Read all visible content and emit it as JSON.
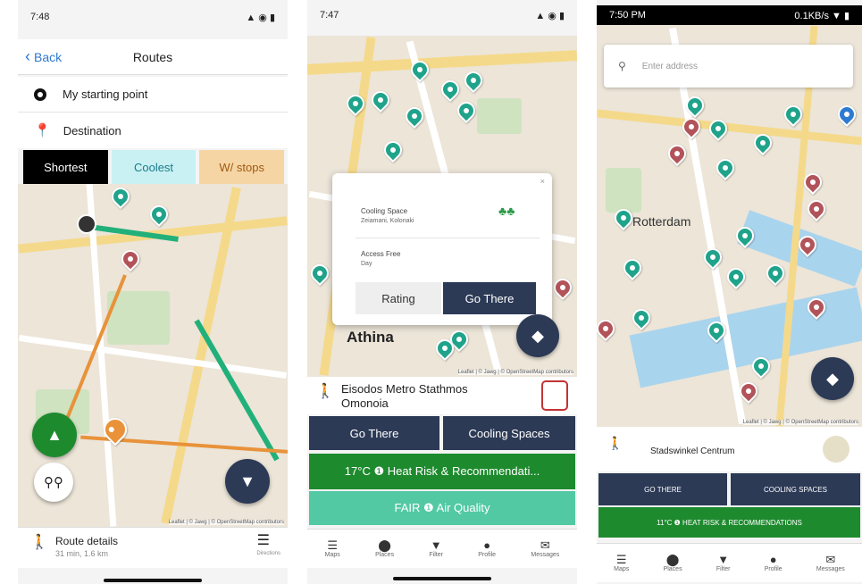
{
  "colors": {
    "teal": "#1fa38a",
    "navy": "#2c3a56",
    "green": "#1e8a2e",
    "mint": "#52c9a3",
    "shortest_bg": "#000000",
    "coolest_bg": "#c9f1f4",
    "stops_bg": "#f6d5a5"
  },
  "phone1": {
    "status": {
      "time": "7:48",
      "icons": "▲ ◉ ▮"
    },
    "header": {
      "back_label": "Back",
      "title": "Routes"
    },
    "starting_point": "My starting point",
    "destination": "Destination",
    "route_tabs": [
      "Shortest",
      "Coolest",
      "W/ stops"
    ],
    "attribution": "Leaflet | © Jawg | © OpenStreetMap contributors",
    "route_details_label": "Route details",
    "route_summary": "31 min, 1.6 km",
    "directions_label": "Directions"
  },
  "phone2": {
    "status": {
      "time": "7:47",
      "icons": "▲ ◉ ▮"
    },
    "popup": {
      "place": "Cooling Space",
      "address": "Zeiamani, Kolonaki",
      "access": "Access Free",
      "access_sub": "Day",
      "rating_label": "Rating",
      "go_there_label": "Go There"
    },
    "city_label": "Athina",
    "attribution": "Leaflet | © Jawg | © OpenStreetMap contributors",
    "station_line1": "Eisodos Metro Stathmos",
    "station_line2": "Omonoia",
    "go_there_label": "Go There",
    "cooling_spaces_label": "Cooling Spaces",
    "heat_risk_label": "17°C ❶ Heat Risk & Recommendati...",
    "air_quality_label": "FAIR ❶ Air Quality",
    "tabs": [
      "Maps",
      "Places",
      "Filter",
      "Profile",
      "Messages"
    ]
  },
  "phone3": {
    "status": {
      "time": "7:50 PM",
      "icons": "0.1KB/s ▼ ▮"
    },
    "search_placeholder": "Enter address",
    "city_label": "Rotterdam",
    "attribution": "Leaflet | © Jawg | © OpenStreetMap contributors",
    "station_label": "Stadswinkel Centrum",
    "go_there_label": "GO THERE",
    "cooling_spaces_label": "COOLING SPACES",
    "heat_risk_label": "11°C ❶ HEAT RISK & RECOMMENDATIONS",
    "tabs": [
      "Maps",
      "Places",
      "Filter",
      "Profile",
      "Messages"
    ]
  }
}
